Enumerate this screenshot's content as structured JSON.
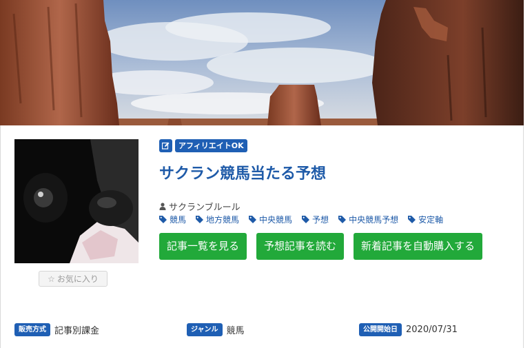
{
  "header": {
    "banner_image": "desert-mesa-landscape"
  },
  "profile": {
    "avatar_image": "dog-closeup-photo",
    "favorite_label": "お気に入り",
    "favorite_icon": "star-outline-icon"
  },
  "badges": {
    "edit_icon": "edit-icon",
    "affiliate_label": "アフィリエイトOK"
  },
  "title": "サクラン競馬当たる予想",
  "author": {
    "icon": "user-icon",
    "name": "サクランブルール"
  },
  "tags": [
    "競馬",
    "地方競馬",
    "中央競馬",
    "予想",
    "中央競馬予想",
    "安定軸"
  ],
  "actions": {
    "list_label": "記事一覧を見る",
    "read_label": "予想記事を読む",
    "auto_buy_label": "新着記事を自動購入する"
  },
  "meta": {
    "sales_label": "販売方式",
    "sales_value": "記事別課金",
    "genre_label": "ジャンル",
    "genre_value": "競馬",
    "start_label": "公開開始日",
    "start_value": "2020/07/31"
  },
  "colors": {
    "accent": "#1f5fb4",
    "title": "#1e5aa8",
    "button": "#22a93a"
  }
}
